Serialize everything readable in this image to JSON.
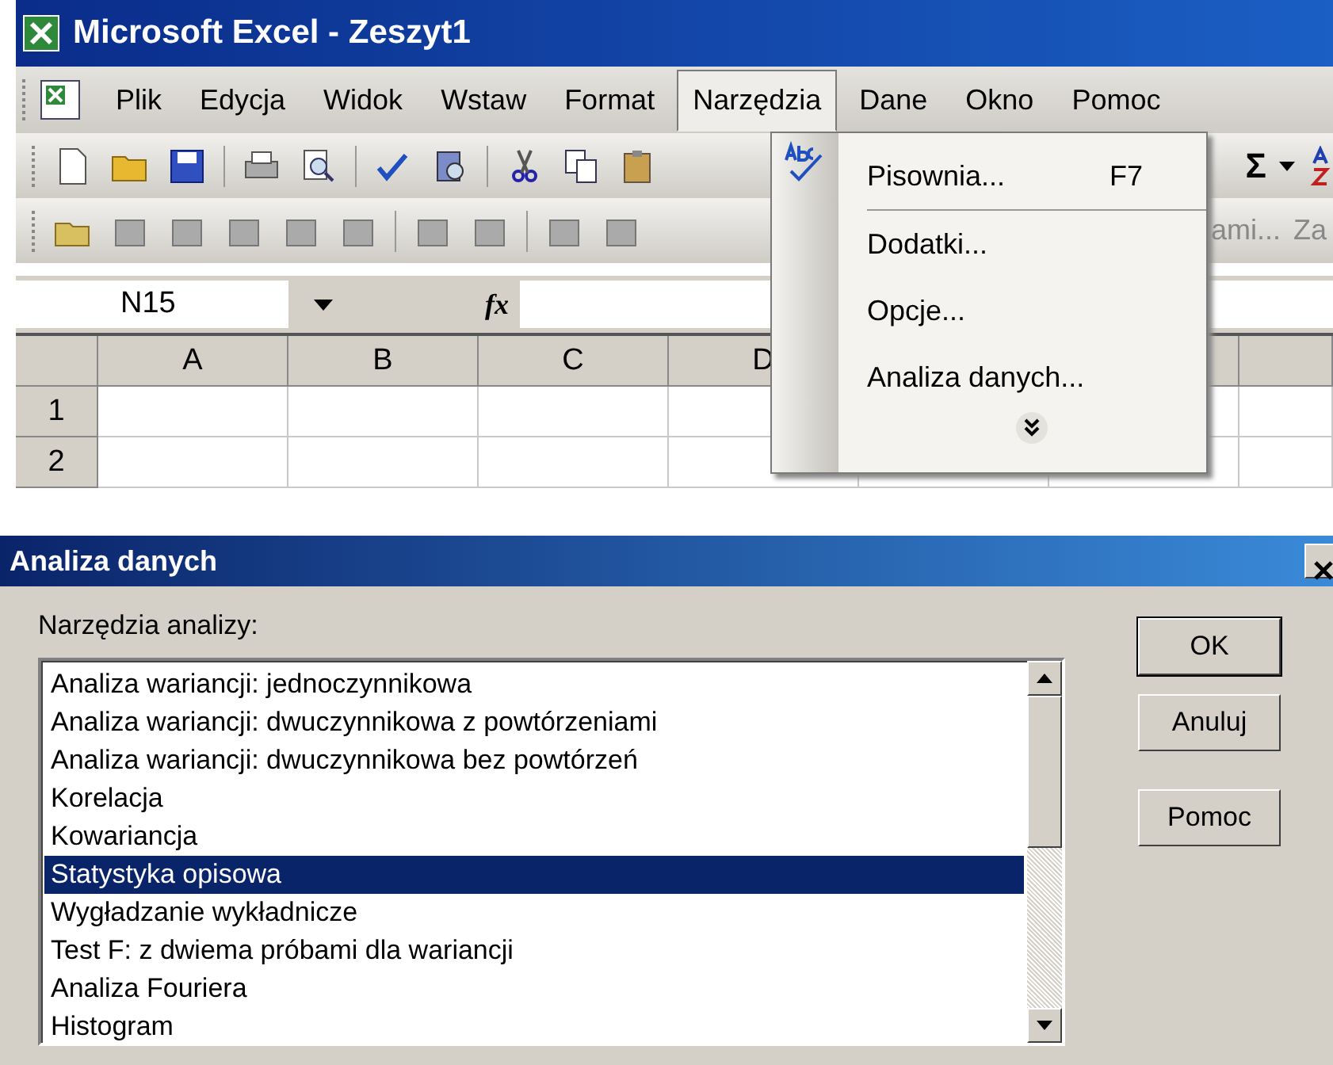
{
  "excel": {
    "window": {
      "title": "Microsoft Excel - Zeszyt1"
    },
    "menu_bar": [
      {
        "label": "Plik",
        "selected": false
      },
      {
        "label": "Edycja",
        "selected": false
      },
      {
        "label": "Widok",
        "selected": false
      },
      {
        "label": "Wstaw",
        "selected": false
      },
      {
        "label": "Format",
        "selected": false
      },
      {
        "label": "Narzędzia",
        "selected": true
      },
      {
        "label": "Dane",
        "selected": false
      },
      {
        "label": "Okno",
        "selected": false
      },
      {
        "label": "Pomoc",
        "selected": false
      }
    ],
    "standard_toolbar": {
      "sum_button": "Σ"
    },
    "reviewing_toolbar": {
      "texts": [
        "ami...",
        "Za"
      ]
    },
    "formula_bar": {
      "name_box": "N15",
      "function_label": "fx"
    },
    "sheet": {
      "columns": [
        "A",
        "B",
        "C",
        "D"
      ],
      "rows": [
        "1",
        "2"
      ]
    },
    "tools_menu": {
      "items": [
        {
          "label": "Pisownia...",
          "shortcut": "F7",
          "separator_after": true
        },
        {
          "label": "Dodatki...",
          "separator_after": false
        },
        {
          "label": "Opcje...",
          "separator_after": false
        },
        {
          "label": "Analiza danych...",
          "separator_after": false
        }
      ]
    }
  },
  "dialog": {
    "title": "Analiza danych",
    "list_label": "Narzędzia analizy:",
    "items": [
      {
        "label": "Analiza wariancji: jednoczynnikowa",
        "selected": false
      },
      {
        "label": "Analiza wariancji: dwuczynnikowa z powtórzeniami",
        "selected": false
      },
      {
        "label": "Analiza wariancji: dwuczynnikowa bez powtórzeń",
        "selected": false
      },
      {
        "label": "Korelacja",
        "selected": false
      },
      {
        "label": "Kowariancja",
        "selected": false
      },
      {
        "label": "Statystyka opisowa",
        "selected": true
      },
      {
        "label": "Wygładzanie wykładnicze",
        "selected": false
      },
      {
        "label": "Test F: z dwiema próbami dla wariancji",
        "selected": false
      },
      {
        "label": "Analiza Fouriera",
        "selected": false
      },
      {
        "label": "Histogram",
        "selected": false
      }
    ],
    "buttons": [
      {
        "label": "OK",
        "default": true
      },
      {
        "label": "Anuluj",
        "default": false
      },
      {
        "label": "Pomoc",
        "default": false
      }
    ]
  }
}
